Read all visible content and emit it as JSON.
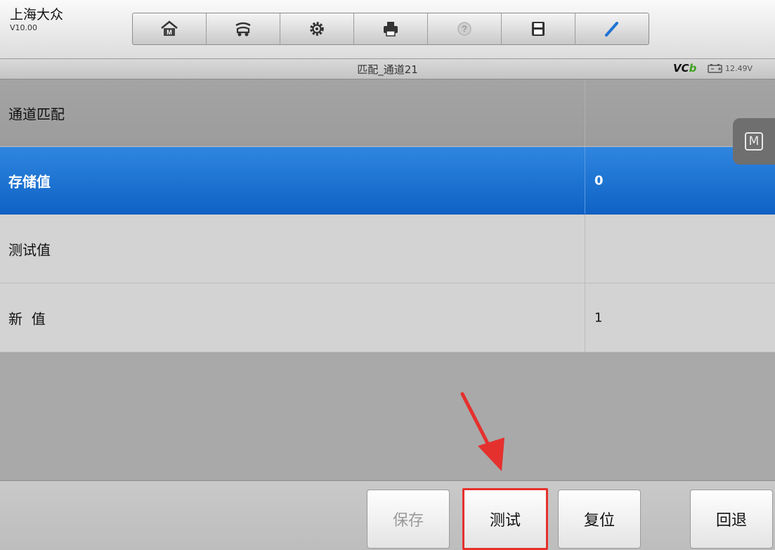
{
  "header": {
    "app_title": "上海大众",
    "version": "V10.00",
    "toolbar_icons": [
      "home-icon",
      "vehicle-icon",
      "settings-icon",
      "print-icon",
      "help-icon",
      "save-icon",
      "edit-icon"
    ]
  },
  "status": {
    "page_title": "匹配_通道21",
    "vci_prefix": "VC",
    "vci_accent": "b",
    "battery_voltage": "12.49V"
  },
  "table": {
    "rows": [
      {
        "label": "通道匹配",
        "value": ""
      },
      {
        "label": "存储值",
        "value": "0"
      },
      {
        "label": "测试值",
        "value": ""
      },
      {
        "label": "新  值",
        "value": "1"
      }
    ]
  },
  "float_tab": {
    "label": "M"
  },
  "buttons": {
    "save": "保存",
    "test": "测试",
    "reset": "复位",
    "back": "回退"
  },
  "colors": {
    "selected_row": "#1f73d4",
    "highlight_border": "#e5312e",
    "vci_accent": "#3ea21f"
  }
}
